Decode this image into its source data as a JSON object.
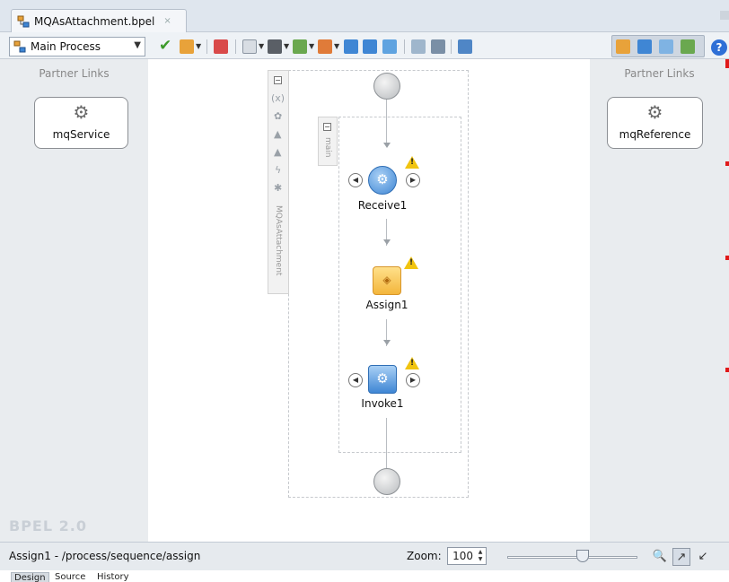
{
  "editor_tab": {
    "title": "MQAsAttachment.bpel",
    "close_glyph": "×",
    "icon": "bpel-process-icon"
  },
  "toolbar": {
    "scope_value": "Main Process",
    "scope_icon": "process-icon"
  },
  "left_panel": {
    "title": "Partner Links",
    "partner_link": "mqService",
    "bpel_version": "BPEL 2.0"
  },
  "right_panel": {
    "title": "Partner Links",
    "partner_link": "mqReference"
  },
  "canvas": {
    "outer_scope_label": "MQAsAttachment",
    "inner_scope_label": "main",
    "activities": [
      {
        "name": "Receive1",
        "type": "receive",
        "warning": true
      },
      {
        "name": "Assign1",
        "type": "assign",
        "warning": true
      },
      {
        "name": "Invoke1",
        "type": "invoke",
        "warning": true
      }
    ],
    "mini_tools": [
      "(x)"
    ]
  },
  "status": {
    "path": "Assign1 - /process/sequence/assign",
    "zoom_label": "Zoom:",
    "zoom_value": "100"
  },
  "bottom_tabs": [
    {
      "label": "Design",
      "active": true
    },
    {
      "label": "Source",
      "active": false
    },
    {
      "label": "History",
      "active": false
    }
  ],
  "colors": {
    "accent_blue": "#3f86d4",
    "assign_gold": "#f3b63c",
    "warning": "#f1c40f",
    "marker_red": "#e01919"
  }
}
